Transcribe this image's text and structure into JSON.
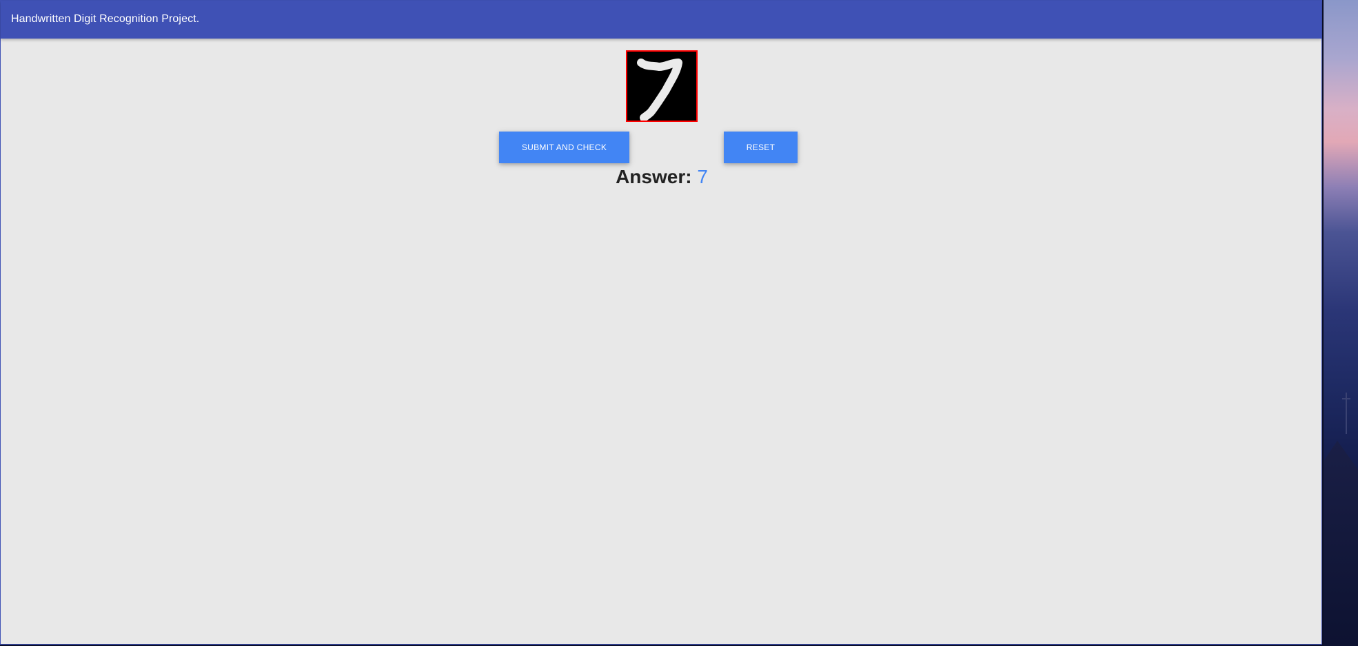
{
  "app": {
    "title": "Handwritten Digit Recognition Project."
  },
  "canvas": {
    "background": "#000000",
    "border_color": "#ff0000",
    "stroke_color": "#ebebeb",
    "drawn_digit": "7"
  },
  "buttons": {
    "submit_label": "SUBMIT AND CHECK",
    "reset_label": "RESET",
    "color": "#4285f4"
  },
  "result": {
    "label": "Answer:",
    "value": "7",
    "value_color": "#4285f4"
  },
  "theme": {
    "navbar_color": "#3f51b5",
    "page_background": "#e8e8e8"
  }
}
